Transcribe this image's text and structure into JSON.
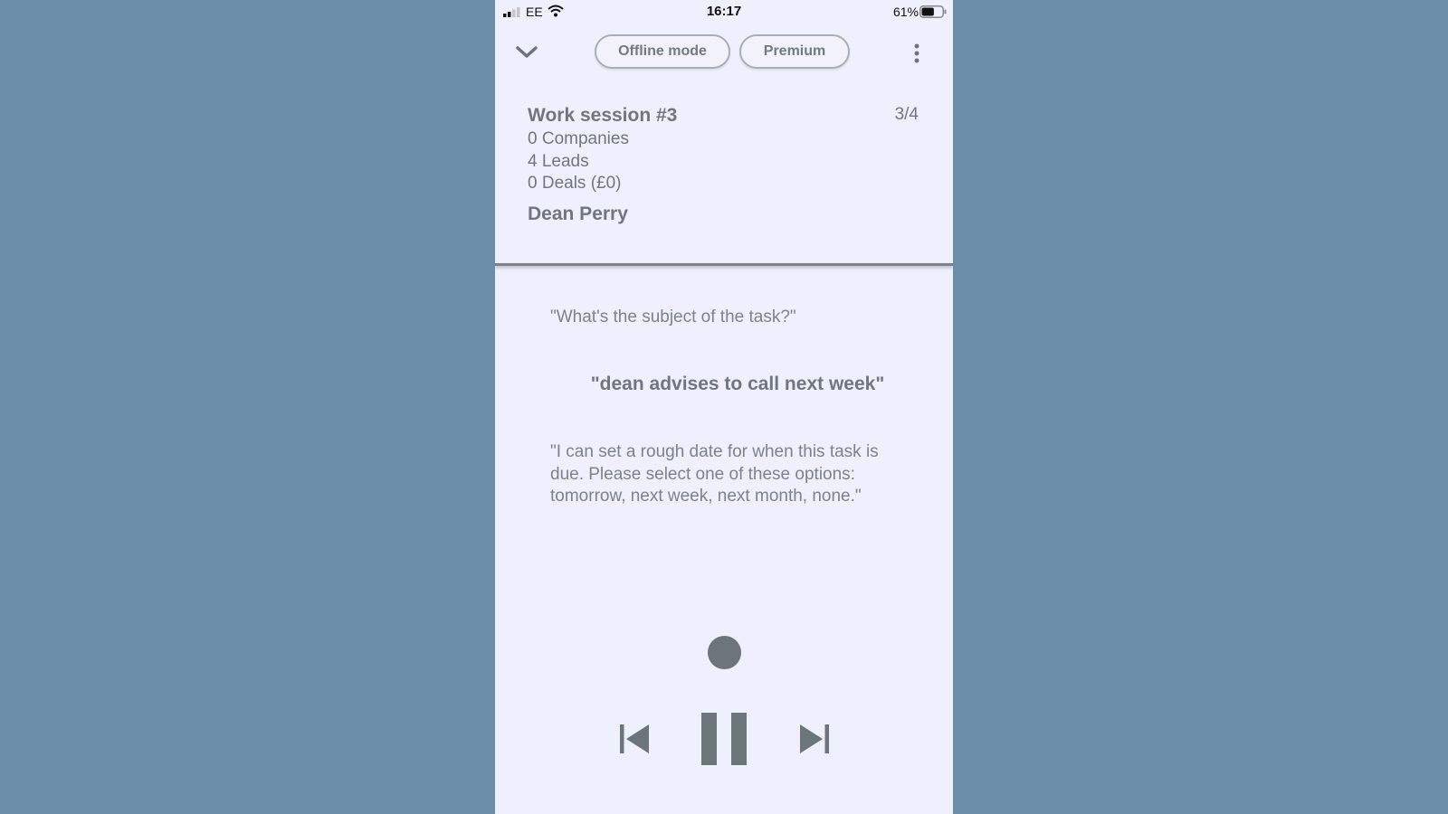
{
  "status_bar": {
    "carrier": "EE",
    "time": "16:17",
    "battery_percent": "61%",
    "battery_level": 0.61,
    "signal_bars": 2,
    "icons": [
      "signal-icon",
      "wifi-icon",
      "battery-icon"
    ]
  },
  "header": {
    "offline_label": "Offline mode",
    "premium_label": "Premium",
    "icons": [
      "chevron-down-icon",
      "more-vertical-icon"
    ]
  },
  "session": {
    "title": "Work session #3",
    "counter": "3/4",
    "companies": "0 Companies",
    "leads": "4 Leads",
    "deals": "0 Deals (£0)",
    "contact": "Dean Perry"
  },
  "conversation": {
    "question": "\"What's the subject of the task?\"",
    "answer": "\"dean advises to call next week\"",
    "followup": "\"I can set a rough date for when this task is due. Please select one of these options: tomorrow, next week, next month, none.\""
  },
  "controls": {
    "icons": [
      "record-icon",
      "skip-previous-icon",
      "pause-icon",
      "skip-next-icon"
    ]
  },
  "colors": {
    "background": "#6b8fab",
    "screen": "#eef0fd",
    "text": "#6f777d",
    "control": "#6c7579"
  }
}
